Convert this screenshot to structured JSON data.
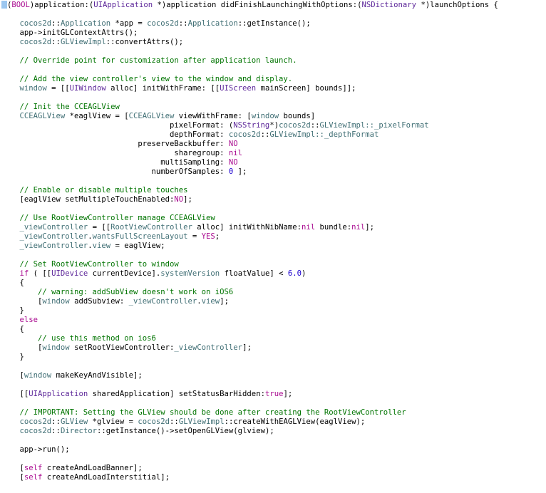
{
  "editor": {
    "lines": [
      [
        {
          "t": "-",
          "c": "plain"
        },
        {
          "t": "(",
          "c": "plain"
        },
        {
          "t": "BOOL",
          "c": "kw"
        },
        {
          "t": ")application:(",
          "c": "plain"
        },
        {
          "t": "UIApplication",
          "c": "type"
        },
        {
          "t": " *)application didFinishLaunchingWithOptions:(",
          "c": "plain"
        },
        {
          "t": "NSDictionary",
          "c": "type"
        },
        {
          "t": " *)launchOptions {",
          "c": "plain"
        }
      ],
      [],
      [
        {
          "t": "    cocos2d",
          "c": "cls"
        },
        {
          "t": "::",
          "c": "plain"
        },
        {
          "t": "Application",
          "c": "cls"
        },
        {
          "t": " *app = ",
          "c": "plain"
        },
        {
          "t": "cocos2d",
          "c": "cls"
        },
        {
          "t": "::",
          "c": "plain"
        },
        {
          "t": "Application",
          "c": "cls"
        },
        {
          "t": "::getInstance();",
          "c": "plain"
        }
      ],
      [
        {
          "t": "    app->initGLContextAttrs();",
          "c": "plain"
        }
      ],
      [
        {
          "t": "    cocos2d",
          "c": "cls"
        },
        {
          "t": "::",
          "c": "plain"
        },
        {
          "t": "GLViewImpl",
          "c": "cls"
        },
        {
          "t": "::convertAttrs();",
          "c": "plain"
        }
      ],
      [],
      [
        {
          "t": "    // Override point for customization after application launch.",
          "c": "cm"
        }
      ],
      [],
      [
        {
          "t": "    // Add the view controller's view to the window and display.",
          "c": "cm"
        }
      ],
      [
        {
          "t": "    window",
          "c": "ivar"
        },
        {
          "t": " = [[",
          "c": "plain"
        },
        {
          "t": "UIWindow",
          "c": "type"
        },
        {
          "t": " alloc] initWithFrame: [[",
          "c": "plain"
        },
        {
          "t": "UIScreen",
          "c": "type"
        },
        {
          "t": " mainScreen] bounds]];",
          "c": "plain"
        }
      ],
      [],
      [
        {
          "t": "    // Init the CCEAGLView",
          "c": "cm"
        }
      ],
      [
        {
          "t": "    CCEAGLView",
          "c": "cls"
        },
        {
          "t": " *eaglView = [",
          "c": "plain"
        },
        {
          "t": "CCEAGLView",
          "c": "cls"
        },
        {
          "t": " viewWithFrame: [",
          "c": "plain"
        },
        {
          "t": "window",
          "c": "ivar"
        },
        {
          "t": " bounds]",
          "c": "plain"
        }
      ],
      [
        {
          "t": "                                     pixelFormat: (",
          "c": "plain"
        },
        {
          "t": "NSString",
          "c": "type"
        },
        {
          "t": "*)",
          "c": "plain"
        },
        {
          "t": "cocos2d",
          "c": "cls"
        },
        {
          "t": "::",
          "c": "plain"
        },
        {
          "t": "GLViewImpl",
          "c": "cls"
        },
        {
          "t": "::_pixelFormat",
          "c": "cls"
        }
      ],
      [
        {
          "t": "                                     depthFormat: ",
          "c": "plain"
        },
        {
          "t": "cocos2d",
          "c": "cls"
        },
        {
          "t": "::",
          "c": "plain"
        },
        {
          "t": "GLViewImpl",
          "c": "cls"
        },
        {
          "t": "::_depthFormat",
          "c": "cls"
        }
      ],
      [
        {
          "t": "                              preserveBackbuffer: ",
          "c": "plain"
        },
        {
          "t": "NO",
          "c": "kw"
        }
      ],
      [
        {
          "t": "                                      sharegroup: ",
          "c": "plain"
        },
        {
          "t": "nil",
          "c": "kw"
        }
      ],
      [
        {
          "t": "                                   multiSampling: ",
          "c": "plain"
        },
        {
          "t": "NO",
          "c": "kw"
        }
      ],
      [
        {
          "t": "                                 numberOfSamples: ",
          "c": "plain"
        },
        {
          "t": "0",
          "c": "num"
        },
        {
          "t": " ];",
          "c": "plain"
        }
      ],
      [],
      [
        {
          "t": "    // Enable or disable multiple touches",
          "c": "cm"
        }
      ],
      [
        {
          "t": "    [eaglView setMultipleTouchEnabled:",
          "c": "plain"
        },
        {
          "t": "NO",
          "c": "kw"
        },
        {
          "t": "];",
          "c": "plain"
        }
      ],
      [],
      [
        {
          "t": "    // Use RootViewController manage CCEAGLView",
          "c": "cm"
        }
      ],
      [
        {
          "t": "    _viewController",
          "c": "ivar"
        },
        {
          "t": " = [[",
          "c": "plain"
        },
        {
          "t": "RootViewController",
          "c": "cls"
        },
        {
          "t": " alloc] initWithNibName:",
          "c": "plain"
        },
        {
          "t": "nil",
          "c": "kw"
        },
        {
          "t": " bundle:",
          "c": "plain"
        },
        {
          "t": "nil",
          "c": "kw"
        },
        {
          "t": "];",
          "c": "plain"
        }
      ],
      [
        {
          "t": "    _viewController",
          "c": "ivar"
        },
        {
          "t": ".",
          "c": "plain"
        },
        {
          "t": "wantsFullScreenLayout",
          "c": "ivar"
        },
        {
          "t": " = ",
          "c": "plain"
        },
        {
          "t": "YES",
          "c": "kw"
        },
        {
          "t": ";",
          "c": "plain"
        }
      ],
      [
        {
          "t": "    _viewController",
          "c": "ivar"
        },
        {
          "t": ".",
          "c": "plain"
        },
        {
          "t": "view",
          "c": "ivar"
        },
        {
          "t": " = eaglView;",
          "c": "plain"
        }
      ],
      [],
      [
        {
          "t": "    // Set RootViewController to window",
          "c": "cm"
        }
      ],
      [
        {
          "t": "    ",
          "c": "plain"
        },
        {
          "t": "if",
          "c": "kw"
        },
        {
          "t": " ( [[",
          "c": "plain"
        },
        {
          "t": "UIDevice",
          "c": "type"
        },
        {
          "t": " currentDevice].",
          "c": "plain"
        },
        {
          "t": "systemVersion",
          "c": "ivar"
        },
        {
          "t": " floatValue] < ",
          "c": "plain"
        },
        {
          "t": "6.0",
          "c": "num"
        },
        {
          "t": ")",
          "c": "plain"
        }
      ],
      [
        {
          "t": "    {",
          "c": "plain"
        }
      ],
      [
        {
          "t": "        // warning: addSubView doesn't work on iOS6",
          "c": "cm"
        }
      ],
      [
        {
          "t": "        [",
          "c": "plain"
        },
        {
          "t": "window",
          "c": "ivar"
        },
        {
          "t": " addSubview: ",
          "c": "plain"
        },
        {
          "t": "_viewController",
          "c": "ivar"
        },
        {
          "t": ".",
          "c": "plain"
        },
        {
          "t": "view",
          "c": "ivar"
        },
        {
          "t": "];",
          "c": "plain"
        }
      ],
      [
        {
          "t": "    }",
          "c": "plain"
        }
      ],
      [
        {
          "t": "    ",
          "c": "plain"
        },
        {
          "t": "else",
          "c": "kw"
        }
      ],
      [
        {
          "t": "    {",
          "c": "plain"
        }
      ],
      [
        {
          "t": "        // use this method on ios6",
          "c": "cm"
        }
      ],
      [
        {
          "t": "        [",
          "c": "plain"
        },
        {
          "t": "window",
          "c": "ivar"
        },
        {
          "t": " setRootViewController:",
          "c": "plain"
        },
        {
          "t": "_viewController",
          "c": "ivar"
        },
        {
          "t": "];",
          "c": "plain"
        }
      ],
      [
        {
          "t": "    }",
          "c": "plain"
        }
      ],
      [],
      [
        {
          "t": "    [",
          "c": "plain"
        },
        {
          "t": "window",
          "c": "ivar"
        },
        {
          "t": " makeKeyAndVisible];",
          "c": "plain"
        }
      ],
      [],
      [
        {
          "t": "    [[",
          "c": "plain"
        },
        {
          "t": "UIApplication",
          "c": "type"
        },
        {
          "t": " sharedApplication] setStatusBarHidden:",
          "c": "plain"
        },
        {
          "t": "true",
          "c": "kw"
        },
        {
          "t": "];",
          "c": "plain"
        }
      ],
      [],
      [
        {
          "t": "    // IMPORTANT: Setting the GLView should be done after creating the RootViewController",
          "c": "cm"
        }
      ],
      [
        {
          "t": "    cocos2d",
          "c": "cls"
        },
        {
          "t": "::",
          "c": "plain"
        },
        {
          "t": "GLView",
          "c": "cls"
        },
        {
          "t": " *glview = ",
          "c": "plain"
        },
        {
          "t": "cocos2d",
          "c": "cls"
        },
        {
          "t": "::",
          "c": "plain"
        },
        {
          "t": "GLViewImpl",
          "c": "cls"
        },
        {
          "t": "::createWithEAGLView(eaglView);",
          "c": "plain"
        }
      ],
      [
        {
          "t": "    cocos2d",
          "c": "cls"
        },
        {
          "t": "::",
          "c": "plain"
        },
        {
          "t": "Director",
          "c": "cls"
        },
        {
          "t": "::getInstance()->setOpenGLView(glview);",
          "c": "plain"
        }
      ],
      [],
      [
        {
          "t": "    app->run();",
          "c": "plain"
        }
      ],
      [],
      [
        {
          "t": "    [",
          "c": "plain"
        },
        {
          "t": "self",
          "c": "kw"
        },
        {
          "t": " createAndLoadBanner];",
          "c": "plain"
        }
      ],
      [
        {
          "t": "    [",
          "c": "plain"
        },
        {
          "t": "self",
          "c": "kw"
        },
        {
          "t": " createAndLoadInterstitial];",
          "c": "plain"
        }
      ]
    ]
  }
}
